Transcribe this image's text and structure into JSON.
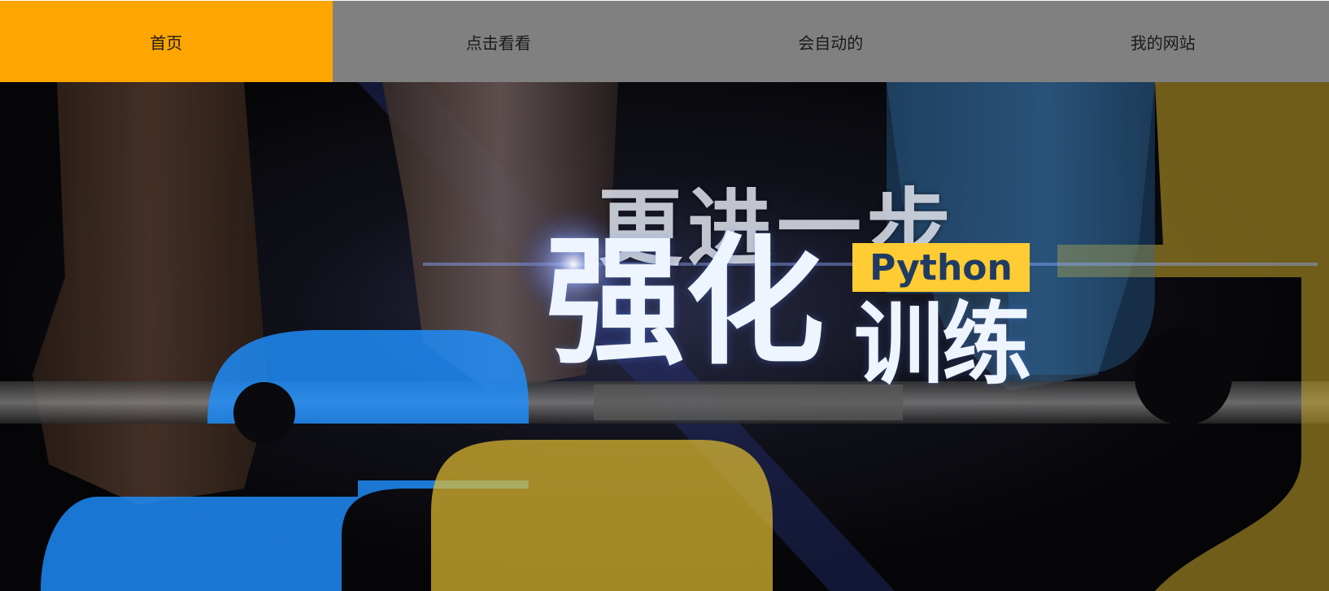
{
  "nav": {
    "items": [
      {
        "label": "首页",
        "active": true
      },
      {
        "label": "点击看看",
        "active": false
      },
      {
        "label": "会自动的",
        "active": false
      },
      {
        "label": "我的网站",
        "active": false
      }
    ],
    "colors": {
      "active_bg": "#ffa500",
      "bar_bg": "#808080"
    }
  },
  "banner": {
    "line1": "更进一步",
    "line2": "强化",
    "line3": "训练",
    "tag": "Python",
    "colors": {
      "tag_bg": "#ffcc33",
      "tag_text": "#1f3b63",
      "logo_blue": "#1e90ff",
      "logo_yellow": "#e6c030"
    },
    "image_subject": "barbell lifting hands with Python logo shapes"
  }
}
